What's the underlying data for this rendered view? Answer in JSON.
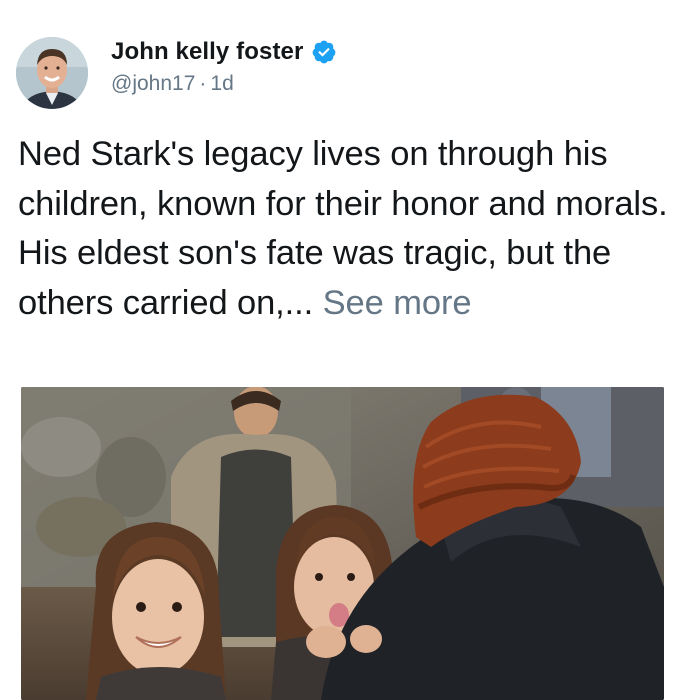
{
  "tweet": {
    "author": {
      "display_name": "John kelly foster",
      "handle": "@john17",
      "verified": true,
      "avatar_icon": "avatar-photo"
    },
    "timestamp": "1d",
    "separator": "·",
    "text": "Ned Stark's legacy lives on through his children, known for their honor and morals. His eldest son's fate was tragic, but the others carried on,...",
    "see_more_label": "See more",
    "media": {
      "type": "photo",
      "icon": "tweet-photo"
    }
  },
  "colors": {
    "text": "#14171a",
    "muted": "#657786",
    "verified_badge": "#1da1f2"
  }
}
